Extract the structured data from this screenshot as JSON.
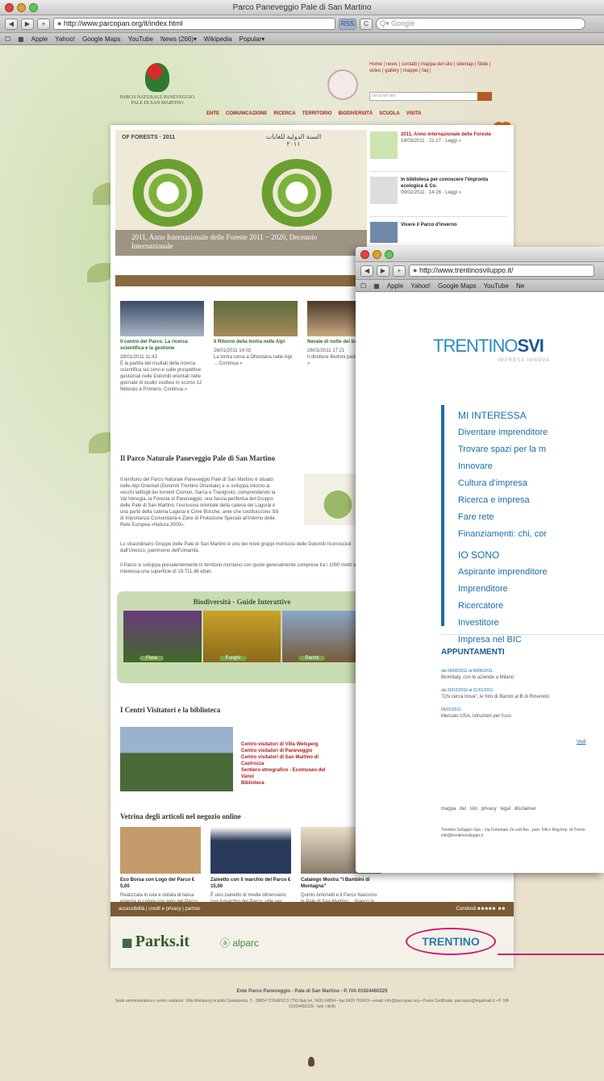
{
  "back_window": {
    "title": "Parco Paneveggio Pale di San Martino",
    "url": "http://www.parcopan.org/it/index.html",
    "search_placeholder": "Google",
    "reload": "C",
    "bookmarks": [
      "Apple",
      "Yahoo!",
      "Google Maps",
      "YouTube",
      "News (266)▾",
      "Wikipedia",
      "Popular▾"
    ]
  },
  "site": {
    "logo_text": "PARCO NATURALE PANEVEGGIO PALE DI SAN MARTINO",
    "top_links": "Home | news | contatti | mappa del sito | sitemap | Slide | video | gallery | mappe | faq | ",
    "nav": [
      "ENTE",
      "COMUNICAZIONE",
      "RICERCA",
      "TERRITORIO",
      "BIODIVERSITÀ",
      "SCUOLA",
      "VISITA"
    ],
    "banner_caption": "2011, Anno Internazionale delle Foreste 2011 ~ 2020, Decennio Internazionale",
    "forests_label": "OF FORESTS · 2011",
    "arabic_label": "السنة الدولية للغابات ٢٠١١",
    "news": [
      {
        "title": "2011, Anno internazionale delle Foreste",
        "date": "14/03/2011 · 21:17 · Leggi »"
      },
      {
        "title": "In biblioteca per conoscere l'impronta ecologica & Co.",
        "date": "09/02/2011 · 14:26 · Leggi »"
      },
      {
        "title": "Vivere il Parco d'inverno",
        "date": ""
      }
    ],
    "articles": [
      {
        "caption": "Il centro del Parco. La ricerca scientifica e la gestione",
        "date": "28/01/2011 11:43",
        "text": "È la partita dei risultati della ricerca scientifica sui cervi e sulle prospettive gestionali nelle Dolomiti orientali nelle giornate di studio svoltesi lo scorso 12 febbraio a Primiero. Continua »"
      },
      {
        "caption": "Il Ritorno della lontra nelle Alpi",
        "date": "26/01/2011 14:02",
        "text": "La lontra torna a Ofondana nelle Alpi ... Continua »"
      },
      {
        "caption": "Nevale di notte dei boschi",
        "date": "26/01/2011 17:21",
        "text": "Il direttore Bertoni parlano ... Continua »"
      }
    ],
    "about_title": "Il Parco Naturale Paneveggio Pale di San Martino",
    "about_text": "Il territorio del Parco Naturale Paneveggio Pale di San Martino è situato nelle Alpi Orientali (Dolomiti Trentino Orientale) e si sviluppa intorno ai vecchi latifogli dei torrenti Cismon, Sarca e Travignolo, comprendendo la Val Venegia, la Foresta di Paneveggio, una fascia periferica del Gruppo delle Pale di San Martino, l'esclusiva orientale della catena dei Lagorai e una parte della catena Lagorai e Cime Bocche, aree che costituiscono Siti di Importanza Comunitaria e Zone di Protezione Speciali all'interno della Rete Europea «Natura 2000».",
    "about_text2": "Lo straordinario Gruppo delle Pale di San Martino è uno dei nove gruppi montuosi delle Dolomiti riconosciuti dall'Unesco, patrimonio dell'Umanità.",
    "about_text3": "Il Parco si sviluppa prevalentemente in territorio montano con quote generalmente comprese tra i 1000 metri e interessa una superficie di 19.711,48 ettari.",
    "bio_title": "Biodiversità - Guide Interattive",
    "bio_items": [
      "Flora",
      "Funghi",
      "Parchi"
    ],
    "centri_title": "I Centri Visitatori e la biblioteca",
    "centri_links": [
      "Centro visitatori di Villa Welsperg",
      "Centro visitatori di Paneveggio",
      "Centro visitatori di San Martino di Castrozza",
      "Sentiero etnografico - Ecomuseo del Vanoi",
      "Biblioteca"
    ],
    "shop_title": "Vetrina degli articoli nel negozio online",
    "shop": [
      {
        "name": "Eco Borsa con Logo del Parco",
        "price": "€ 5,00",
        "desc": "Realizzata in iuta e dotata di tasca esterna in colore con logo del Parco in tre diversi colori."
      },
      {
        "name": "Zainetto con il marchio del Parco",
        "price": "€ 15,00",
        "desc": "È uno zainetto di medie dimensioni, con il marchio del Parco, utile per piccole escursioni e per le attività quotidiane. Dimensioni: cm 40x32x20 ca. Sopra top a giorno fissaggio tracolla e chiusa con cerniera e taschino interno."
      },
      {
        "name": "Catalogo Mostra \"I Bambini di Montagna\"",
        "price": "",
        "desc": "Quinto Antonelli e il Parco Nascono le Pale di San Martino ... bianco in Trentino, domicilio da un libro ... nascono entrate, orientale la vita dei bambini. Il catalogo raccoglie testimonianze e fotografie sull'infanzia tra ..."
      }
    ],
    "footer_links": "accessibilità | credit e privacy | partner",
    "footer_share": "Condividi",
    "parks_logo": "Parks.it",
    "alparc_logo": "alparc",
    "trentino_logo": "TRENTINO",
    "bottom_org": "Ente Parco Paneveggio - Pale di San Martino - P. IVA 01924460229",
    "bottom_addr": "Sede amministrativa e centro visitatori: Villa Welsperg località Castelpietra, 2 - 38054 TONADICO (TN) Italy tel. 0439 64854 • fax 0439 762419 • email: info@parcopan.org • Posta Certificata: parcopan@legalmail.it • P. IVA 01924460229 - tutti i diritti"
  },
  "front_window": {
    "url": "http://www.trentinosviluppo.it/",
    "bookmarks": [
      "Apple",
      "Yahoo!",
      "Google Maps",
      "YouTube",
      "Ne"
    ],
    "logo_a": "TRENTINO",
    "logo_b": "SVI",
    "tagline": "IMPRESA INNOVA",
    "interessa_title": "MI INTERESSA",
    "interessa": [
      "Diventare imprenditore",
      "Trovare spazi per la m",
      "Innovare",
      "Cultura d'impresa",
      "Ricerca e impresa",
      "Fare rete",
      "Finanziamenti: chi, cor"
    ],
    "sono_title": "IO SONO",
    "sono": [
      "Aspirante imprenditore",
      "Imprenditore",
      "Ricercatore",
      "Investitore",
      "Impresa nel BIC"
    ],
    "appuntamenti_title": "APPUNTAMENTI",
    "appuntamenti": [
      {
        "date": "dal 06/06/2011 al 08/06/2011",
        "text": "Biomitaly, con le aziende a Milano"
      },
      {
        "date": "dal 20/12/2010 al 21/01/2011",
        "text": "\"Chi cerca trova\", le foto di Baroni al B di Rovereto"
      },
      {
        "date": "06/01/2011",
        "text": "Mercato USA, istruzioni per l'uso"
      }
    ],
    "vedi": "Vedi",
    "footer_links": "mappa del sito   privacy   legal disclaimer",
    "footer_addr": "Trentino Sviluppo Spa - Via Fortunato Ze cod.fisc., part. IVA e Reg.Imp. di Trento info@trentinosviluppo.it"
  },
  "colors": {
    "accent_blue": "#1a6eaa",
    "accent_red": "#b01a1a",
    "callout": "#d2186d",
    "park_brown": "#7a5a32"
  }
}
